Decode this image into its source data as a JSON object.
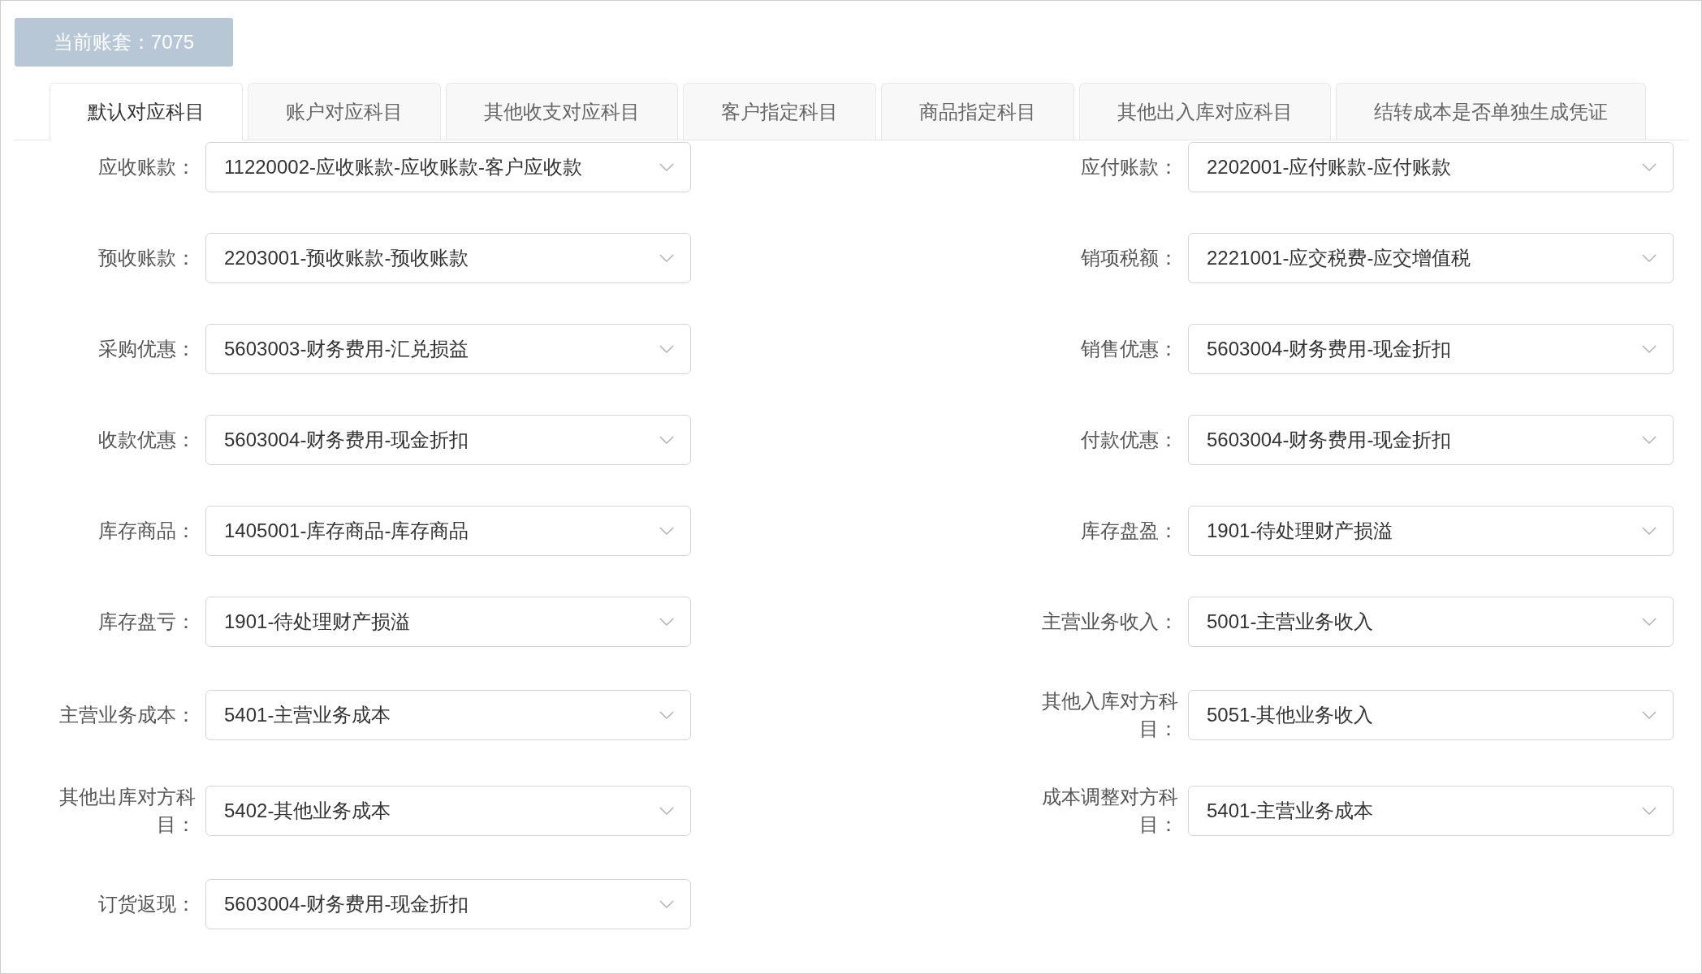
{
  "account_button": {
    "label": "当前账套：7075"
  },
  "tabs": [
    {
      "label": "默认对应科目",
      "selected": true
    },
    {
      "label": "账户对应科目",
      "selected": false
    },
    {
      "label": "其他收支对应科目",
      "selected": false
    },
    {
      "label": "客户指定科目",
      "selected": false
    },
    {
      "label": "商品指定科目",
      "selected": false
    },
    {
      "label": "其他出入库对应科目",
      "selected": false
    },
    {
      "label": "结转成本是否单独生成凭证",
      "selected": false
    }
  ],
  "fields": [
    {
      "label": "应收账款：",
      "value": "11220002-应收账款-应收账款-客户应收款"
    },
    {
      "label": "应付账款：",
      "value": "2202001-应付账款-应付账款"
    },
    {
      "label": "预收账款：",
      "value": "2203001-预收账款-预收账款"
    },
    {
      "label": "销项税额：",
      "value": "2221001-应交税费-应交增值税"
    },
    {
      "label": "采购优惠：",
      "value": "5603003-财务费用-汇兑损益"
    },
    {
      "label": "销售优惠：",
      "value": "5603004-财务费用-现金折扣"
    },
    {
      "label": "收款优惠：",
      "value": "5603004-财务费用-现金折扣"
    },
    {
      "label": "付款优惠：",
      "value": "5603004-财务费用-现金折扣"
    },
    {
      "label": "库存商品：",
      "value": "1405001-库存商品-库存商品"
    },
    {
      "label": "库存盘盈：",
      "value": "1901-待处理财产损溢"
    },
    {
      "label": "库存盘亏：",
      "value": "1901-待处理财产损溢"
    },
    {
      "label": "主营业务收入：",
      "value": "5001-主营业务收入"
    },
    {
      "label": "主营业务成本：",
      "value": "5401-主营业务成本"
    },
    {
      "label": "其他入库对方科目：",
      "value": "5051-其他业务收入"
    },
    {
      "label": "其他出库对方科目：",
      "value": "5402-其他业务成本"
    },
    {
      "label": "成本调整对方科目：",
      "value": "5401-主营业务成本"
    },
    {
      "label": "订货返现：",
      "value": "5603004-财务费用-现金折扣"
    }
  ]
}
